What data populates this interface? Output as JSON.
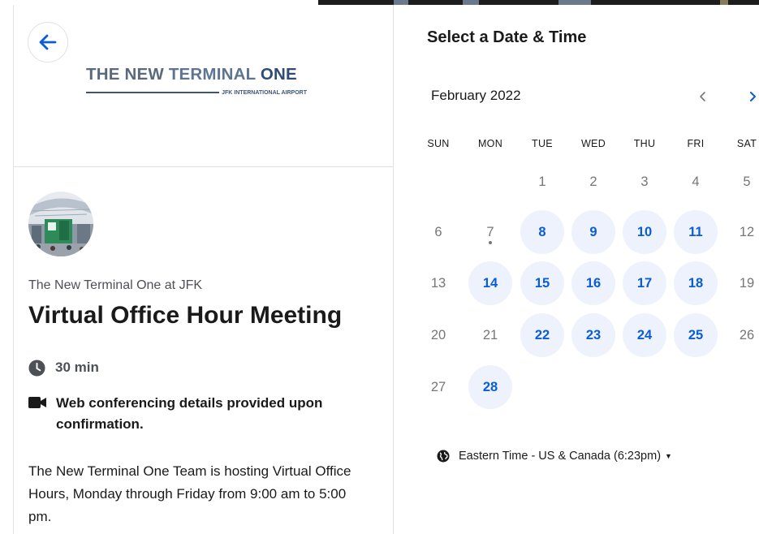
{
  "logo": {
    "line1_part1": "THE NEW ",
    "line1_part2": "TERMINAL ",
    "line1_part3": "ONE",
    "line2": "JFK INTERNATIONAL AIRPORT"
  },
  "event": {
    "organizer": "The New Terminal One at JFK",
    "title": "Virtual Office Hour Meeting",
    "duration": "30 min",
    "location": "Web conferencing details provided upon confirmation.",
    "description": "The New Terminal One Team is hosting Virtual Office Hours, Monday through Friday from 9:00 am to 5:00 pm."
  },
  "calendar": {
    "heading": "Select a Date & Time",
    "month_label": "February 2022",
    "weekdays": [
      "SUN",
      "MON",
      "TUE",
      "WED",
      "THU",
      "FRI",
      "SAT"
    ],
    "weeks": [
      [
        "",
        "",
        "1",
        "2",
        "3",
        "4",
        "5"
      ],
      [
        "6",
        "7",
        "8",
        "9",
        "10",
        "11",
        "12"
      ],
      [
        "13",
        "14",
        "15",
        "16",
        "17",
        "18",
        "19"
      ],
      [
        "20",
        "21",
        "22",
        "23",
        "24",
        "25",
        "26"
      ],
      [
        "27",
        "28",
        "",
        "",
        "",
        "",
        ""
      ]
    ],
    "available_days": [
      "8",
      "9",
      "10",
      "11",
      "14",
      "15",
      "16",
      "17",
      "18",
      "22",
      "23",
      "24",
      "25",
      "28"
    ],
    "today": "7",
    "timezone": "Eastern Time - US & Canada (6:23pm)"
  },
  "colors": {
    "accent": "#0b5cd7",
    "available_bg": "#edf2fd",
    "muted_text": "#767676"
  },
  "icons": {
    "back": "arrow-left-icon",
    "prev": "chevron-left-icon",
    "next": "chevron-right-icon",
    "duration": "clock-icon",
    "location": "video-camera-icon",
    "timezone": "globe-icon",
    "dropdown": "caret-down-icon"
  }
}
